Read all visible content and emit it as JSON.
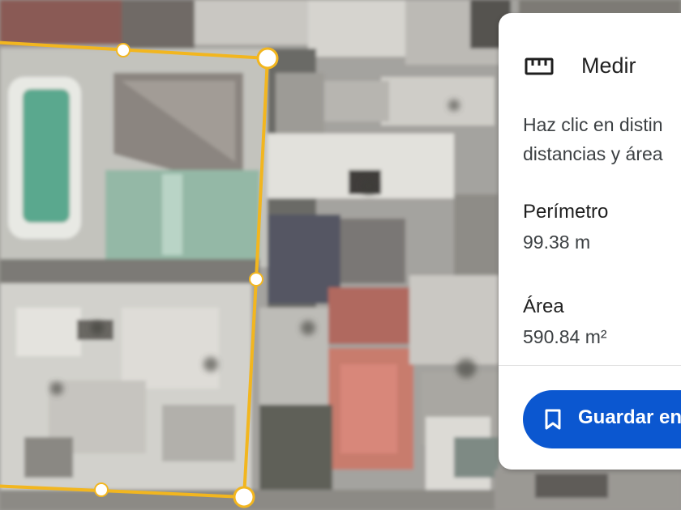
{
  "measure_panel": {
    "icon": "ruler-icon",
    "title": "Medir",
    "description_line1": "Haz clic en distin",
    "description_line2": "distancias y área",
    "perimeter_label": "Perímetro",
    "perimeter_value": "99.38 m",
    "area_label": "Área",
    "area_value": "590.84 m²",
    "save_icon": "bookmark-icon",
    "save_label": "Guardar en"
  },
  "colors": {
    "measure_line": "#f2b61f",
    "save_button": "#0b57d0",
    "panel_background": "#ffffff"
  }
}
